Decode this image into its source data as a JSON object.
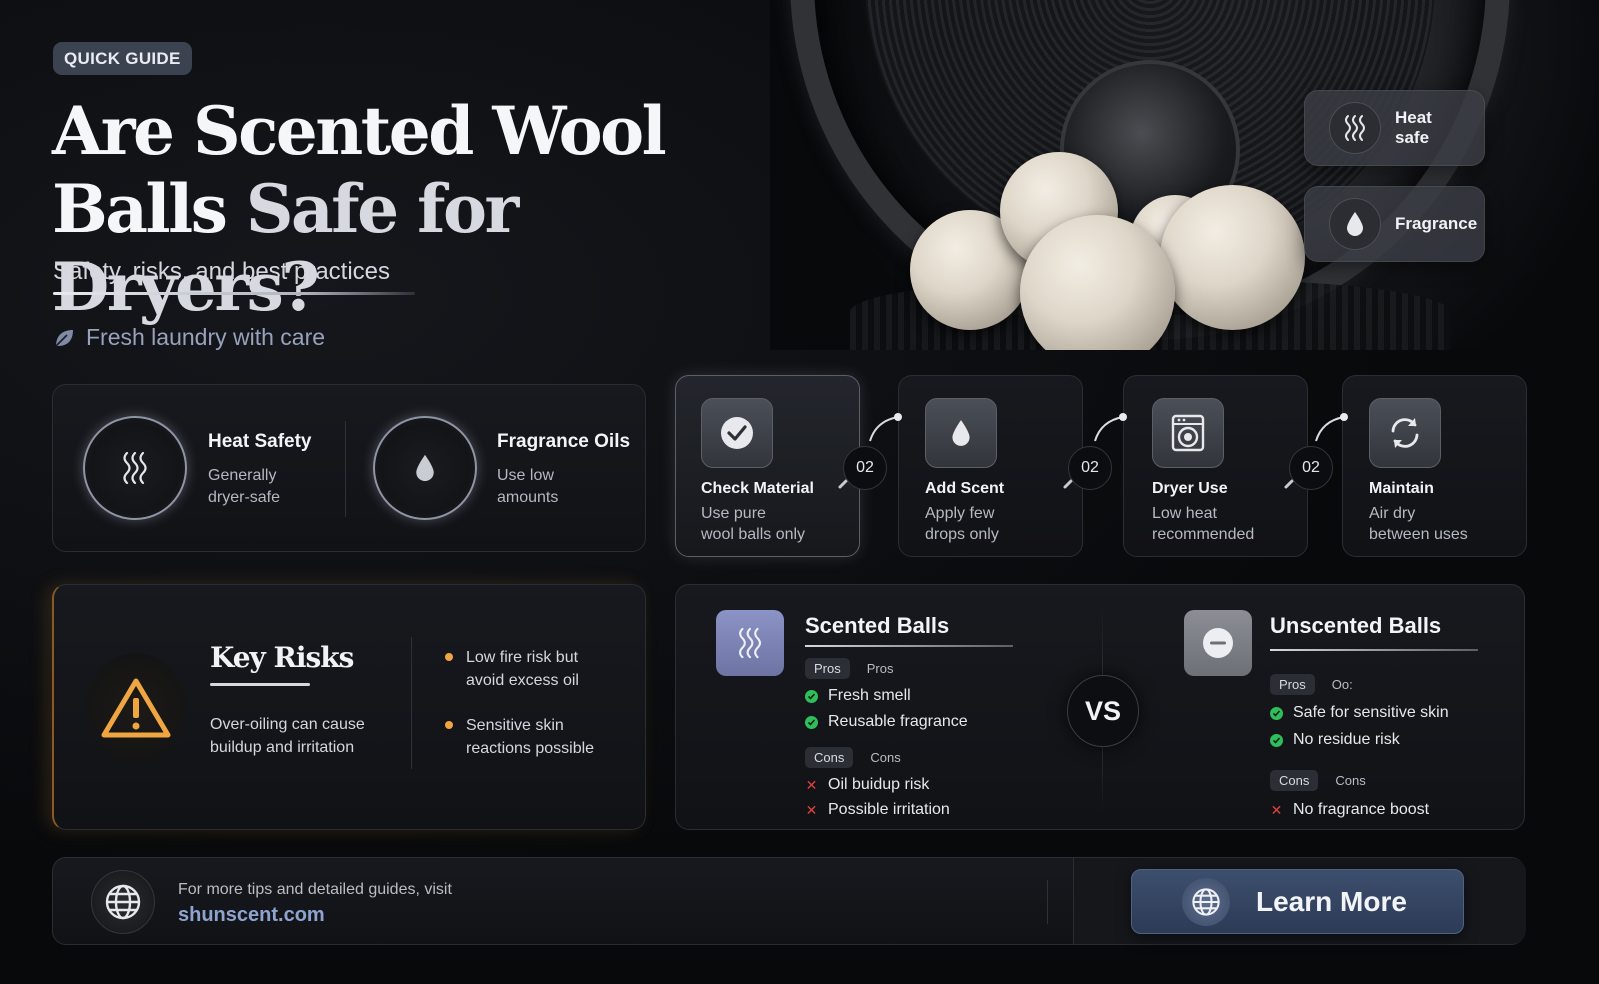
{
  "hero": {
    "badge": "QUICK GUIDE",
    "title_line1": "Are Scented Wool",
    "title_line2a": "Balls",
    "title_line2b": "Safe for Dryers?",
    "subtitle": "Safety, risks, and best practices",
    "tagline": "Fresh laundry with care",
    "tagline_icon": "leaf-icon"
  },
  "chips": [
    {
      "label_line1": "Heat",
      "label_line2": "safe",
      "icon": "heat-waves-icon"
    },
    {
      "label_line1": "Fragrance",
      "icon": "droplet-icon"
    }
  ],
  "safety": {
    "heat_title": "Heat Safety",
    "heat_line1": "Generally",
    "heat_line2": "dryer-safe",
    "oil_title": "Fragrance Oils",
    "oil_line1": "Use low",
    "oil_line2": "amounts"
  },
  "steps": [
    {
      "title": "Check Material",
      "line1": "Use pure",
      "line2": "wool balls only",
      "icon": "check-icon"
    },
    {
      "title": "Add Scent",
      "line1": "Apply few",
      "line2": "drops only",
      "icon": "droplet-icon"
    },
    {
      "title": "Dryer Use",
      "line1": "Low heat",
      "line2": "recommended",
      "icon": "dryer-icon"
    },
    {
      "title": "Maintain",
      "line1": "Air dry",
      "line2": "between uses",
      "icon": "refresh-icon"
    }
  ],
  "connectors": [
    "02",
    "02",
    "02"
  ],
  "risks": {
    "title": "Key Risks",
    "desc_line1": "Over-oiling can cause",
    "desc_line2": "buildup and irritation",
    "b1_line1": "Low fire risk but",
    "b1_line2": "avoid excess oil",
    "b2_line1": "Sensitive skin",
    "b2_line2": "reactions possible"
  },
  "compare": {
    "vs": "VS",
    "scented": {
      "title": "Scented Balls",
      "pros_pill": "Pros",
      "pros_ghost": "Pros",
      "pros": [
        "Fresh smell",
        "Reusable fragrance"
      ],
      "cons_pill": "Cons",
      "cons_ghost": "Cons",
      "cons": [
        "Oil buidup risk",
        "Possible irritation"
      ]
    },
    "unscented": {
      "title": "Unscented Balls",
      "pros_pill": "Pros",
      "pros_ghost": "Oo:",
      "pros": [
        "Safe for sensitive skin",
        "No residue risk"
      ],
      "cons_pill": "Cons",
      "cons_ghost": "Cons",
      "cons": [
        "No fragrance boost"
      ]
    }
  },
  "footer": {
    "text": "For more tips and detailed guides, visit",
    "link": "shunscent.com",
    "button": "Learn More",
    "icon": "globe-icon"
  },
  "colors": {
    "background": "#08090b",
    "accent_orange": "#f0a640",
    "check_green": "#2fbf5a",
    "cross_red": "#e0413c",
    "button_blue": "#3d4f6e",
    "scented_icon": "#7f86b6"
  }
}
